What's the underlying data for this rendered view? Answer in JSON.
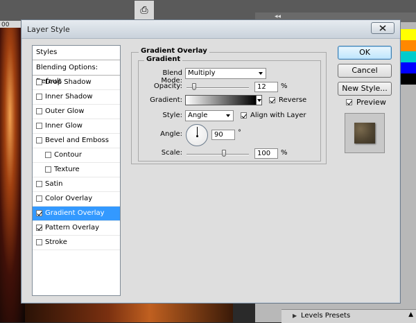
{
  "workspace": {
    "ruler_label": "00",
    "collapse_label": "◂◂",
    "levels_presets_label": "Levels Presets"
  },
  "dialog": {
    "title": "Layer Style",
    "close_label": "x"
  },
  "styles_list": {
    "header": "Styles",
    "blending_options": "Blending Options: Default",
    "items": [
      {
        "label": "Drop Shadow",
        "checked": false,
        "selected": false,
        "sub": false
      },
      {
        "label": "Inner Shadow",
        "checked": false,
        "selected": false,
        "sub": false
      },
      {
        "label": "Outer Glow",
        "checked": false,
        "selected": false,
        "sub": false
      },
      {
        "label": "Inner Glow",
        "checked": false,
        "selected": false,
        "sub": false
      },
      {
        "label": "Bevel and Emboss",
        "checked": false,
        "selected": false,
        "sub": false
      },
      {
        "label": "Contour",
        "checked": false,
        "selected": false,
        "sub": true
      },
      {
        "label": "Texture",
        "checked": false,
        "selected": false,
        "sub": true
      },
      {
        "label": "Satin",
        "checked": false,
        "selected": false,
        "sub": false
      },
      {
        "label": "Color Overlay",
        "checked": false,
        "selected": false,
        "sub": false
      },
      {
        "label": "Gradient Overlay",
        "checked": true,
        "selected": true,
        "sub": false
      },
      {
        "label": "Pattern Overlay",
        "checked": true,
        "selected": false,
        "sub": false
      },
      {
        "label": "Stroke",
        "checked": false,
        "selected": false,
        "sub": false
      }
    ]
  },
  "gradient_overlay": {
    "section_title": "Gradient Overlay",
    "group_title": "Gradient",
    "blend_mode_label": "Blend Mode:",
    "blend_mode_value": "Multiply",
    "opacity_label": "Opacity:",
    "opacity_value": "12",
    "opacity_fraction": 0.12,
    "opacity_unit": "%",
    "gradient_label": "Gradient:",
    "reverse_label": "Reverse",
    "reverse_checked": true,
    "style_label": "Style:",
    "style_value": "Angle",
    "align_label": "Align with Layer",
    "align_checked": true,
    "angle_label": "Angle:",
    "angle_value": "90",
    "angle_unit": "°",
    "scale_label": "Scale:",
    "scale_value": "100",
    "scale_fraction": 0.4,
    "scale_unit": "%"
  },
  "buttons": {
    "ok": "OK",
    "cancel": "Cancel",
    "new_style": "New Style...",
    "preview_label": "Preview",
    "preview_checked": true
  },
  "colors": {
    "selection": "#3399ff",
    "dialog_bg": "#dedede"
  }
}
